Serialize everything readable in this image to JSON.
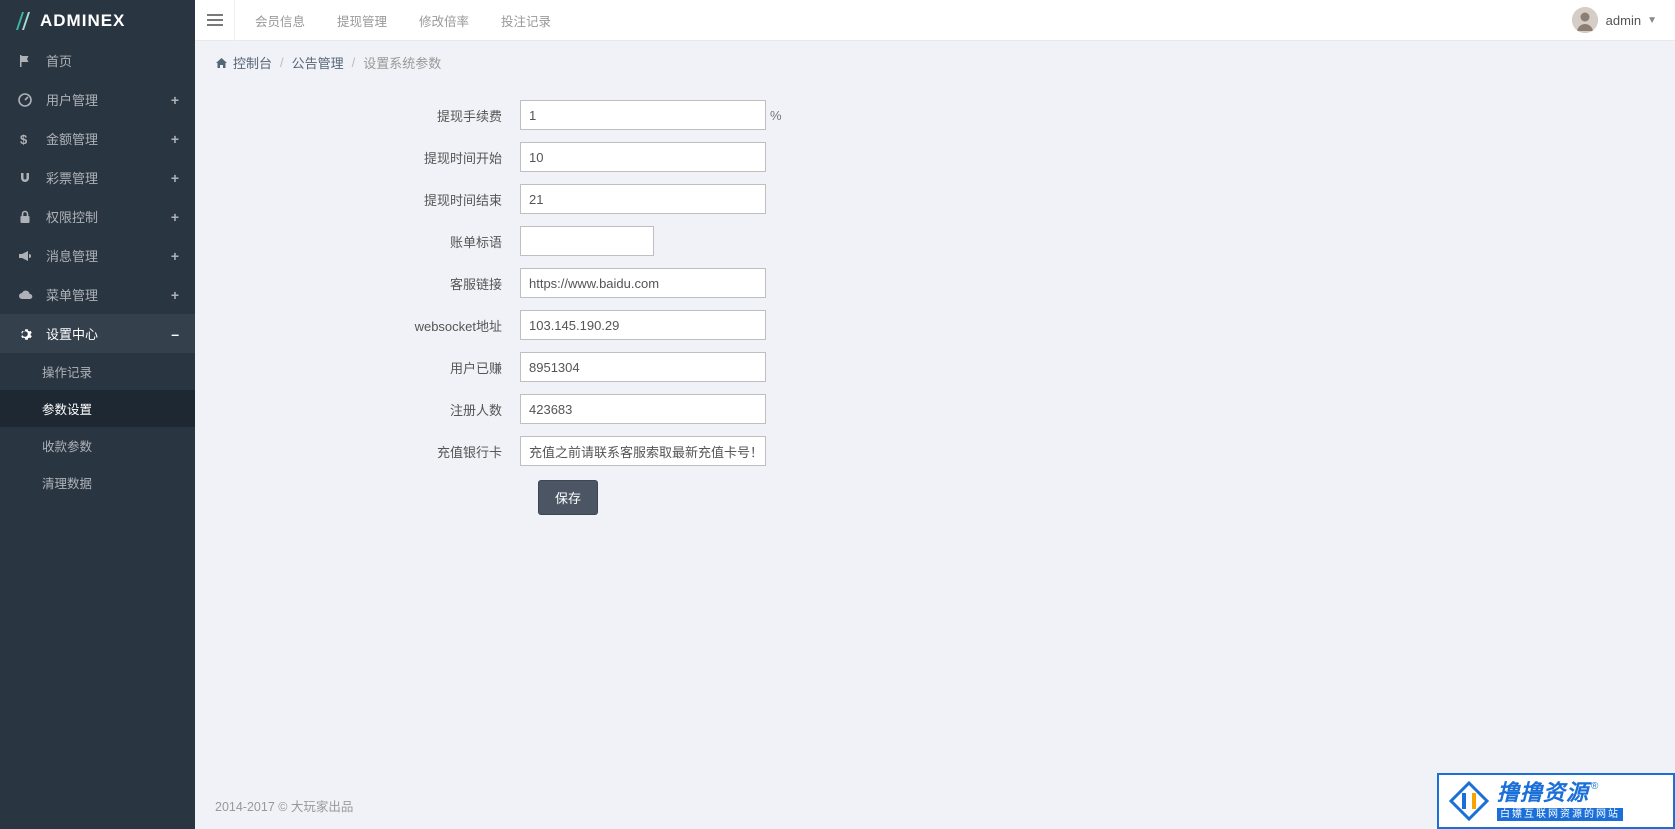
{
  "brand": "ADMINEX",
  "sidebar": {
    "items": [
      {
        "label": "首页",
        "icon": "flag",
        "toggle": ""
      },
      {
        "label": "用户管理",
        "icon": "dashboard",
        "toggle": "+"
      },
      {
        "label": "金额管理",
        "icon": "dollar",
        "toggle": "+"
      },
      {
        "label": "彩票管理",
        "icon": "magnet",
        "toggle": "+"
      },
      {
        "label": "权限控制",
        "icon": "lock",
        "toggle": "+"
      },
      {
        "label": "消息管理",
        "icon": "bullhorn",
        "toggle": "+"
      },
      {
        "label": "菜单管理",
        "icon": "cloud",
        "toggle": "+"
      },
      {
        "label": "设置中心",
        "icon": "gear",
        "toggle": "–"
      }
    ],
    "sub": [
      {
        "label": "操作记录"
      },
      {
        "label": "参数设置"
      },
      {
        "label": "收款参数"
      },
      {
        "label": "清理数据"
      }
    ]
  },
  "topbar": {
    "tabs": [
      "会员信息",
      "提现管理",
      "修改倍率",
      "投注记录"
    ],
    "user": "admin"
  },
  "breadcrumb": {
    "home": "控制台",
    "mid": "公告管理",
    "current": "设置系统参数"
  },
  "form": {
    "fields": [
      {
        "label": "提现手续费",
        "value": "1",
        "suffix": "%",
        "size": "lg"
      },
      {
        "label": "提现时间开始",
        "value": "10",
        "suffix": "",
        "size": "lg"
      },
      {
        "label": "提现时间结束",
        "value": "21",
        "suffix": "",
        "size": "lg"
      },
      {
        "label": "账单标语",
        "value": "",
        "suffix": "",
        "size": "sm"
      },
      {
        "label": "客服链接",
        "value": "https://www.baidu.com",
        "suffix": "",
        "size": "lg"
      },
      {
        "label": "websocket地址",
        "value": "103.145.190.29",
        "suffix": "",
        "size": "lg"
      },
      {
        "label": "用户已赚",
        "value": "8951304",
        "suffix": "",
        "size": "lg"
      },
      {
        "label": "注册人数",
        "value": "423683",
        "suffix": "",
        "size": "lg"
      },
      {
        "label": "充值银行卡",
        "value": "充值之前请联系客服索取最新充值卡号！",
        "suffix": "",
        "size": "lg"
      }
    ],
    "save": "保存"
  },
  "footer": "2014-2017 © 大玩家出品",
  "watermark": {
    "title": "撸撸资源",
    "reg": "®",
    "sub": "白嫖互联网资源的网站"
  }
}
